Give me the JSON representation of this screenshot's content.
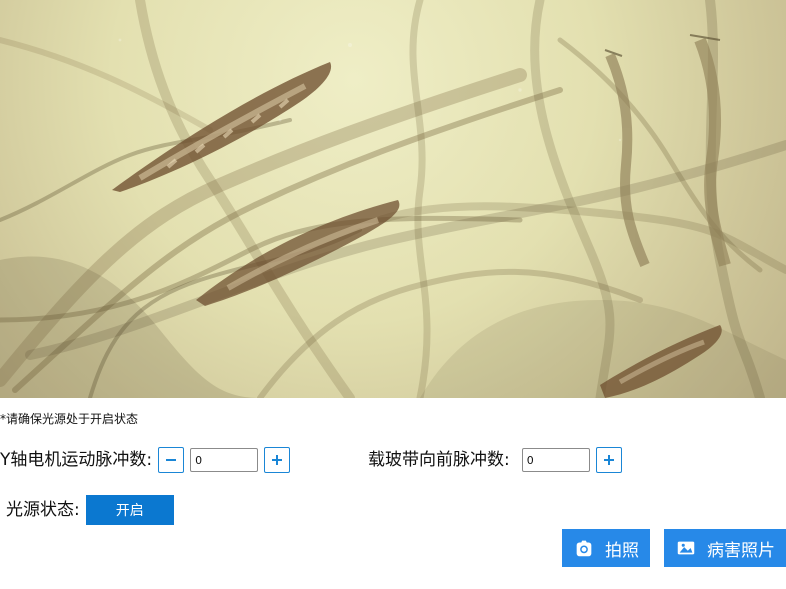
{
  "microscope": {
    "image_name": "microscope-image"
  },
  "notice": "*请确保光源处于开启状态",
  "controls": {
    "y_axis": {
      "label": "Y轴电机运动脉冲数:",
      "value": "0",
      "minus_icon": "minus-icon",
      "plus_icon": "plus-icon"
    },
    "slide_belt": {
      "label": "载玻带向前脉冲数:",
      "value": "0",
      "plus_icon": "plus-icon"
    },
    "light": {
      "label": "光源状态:",
      "state": "开启"
    }
  },
  "actions": {
    "photo": {
      "label": "拍照",
      "icon": "camera-icon"
    },
    "disease_photos": {
      "label": "病害照片",
      "icon": "image-icon"
    }
  },
  "colors": {
    "accent": "#2789e8",
    "accent_dark": "#0b78d0",
    "text": "#111111"
  }
}
